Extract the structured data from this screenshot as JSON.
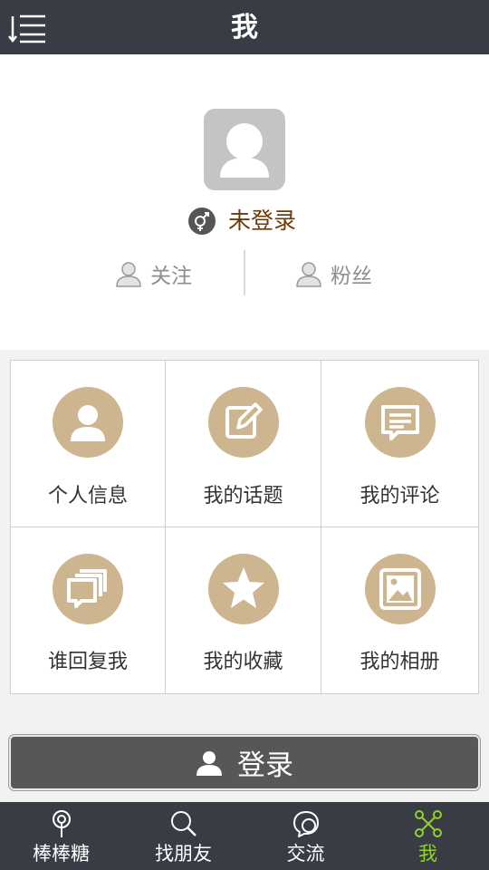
{
  "header": {
    "title": "我",
    "menu_icon": "list-menu-icon"
  },
  "profile": {
    "avatar_icon": "user-avatar-icon",
    "gender_icon": "gender-icon",
    "status": "未登录",
    "follow_label": "关注",
    "fans_label": "粉丝"
  },
  "grid": {
    "items": [
      {
        "label": "个人信息",
        "icon": "person-icon"
      },
      {
        "label": "我的话题",
        "icon": "edit-icon"
      },
      {
        "label": "我的评论",
        "icon": "comment-icon"
      },
      {
        "label": "谁回复我",
        "icon": "chat-bubbles-icon"
      },
      {
        "label": "我的收藏",
        "icon": "star-icon"
      },
      {
        "label": "我的相册",
        "icon": "image-icon"
      }
    ]
  },
  "login_button": {
    "label": "登录",
    "icon": "person-icon"
  },
  "tabbar": {
    "tabs": [
      {
        "label": "棒棒糖",
        "icon": "lollipop-icon"
      },
      {
        "label": "找朋友",
        "icon": "search-icon"
      },
      {
        "label": "交流",
        "icon": "chat-icon"
      },
      {
        "label": "我",
        "icon": "network-icon",
        "active": true
      }
    ]
  },
  "colors": {
    "header_bg": "#393c44",
    "icon_circle": "#cdb68f",
    "active_tab": "#8fd22a",
    "status_text": "#6b3c0a",
    "login_bg": "#575757"
  }
}
